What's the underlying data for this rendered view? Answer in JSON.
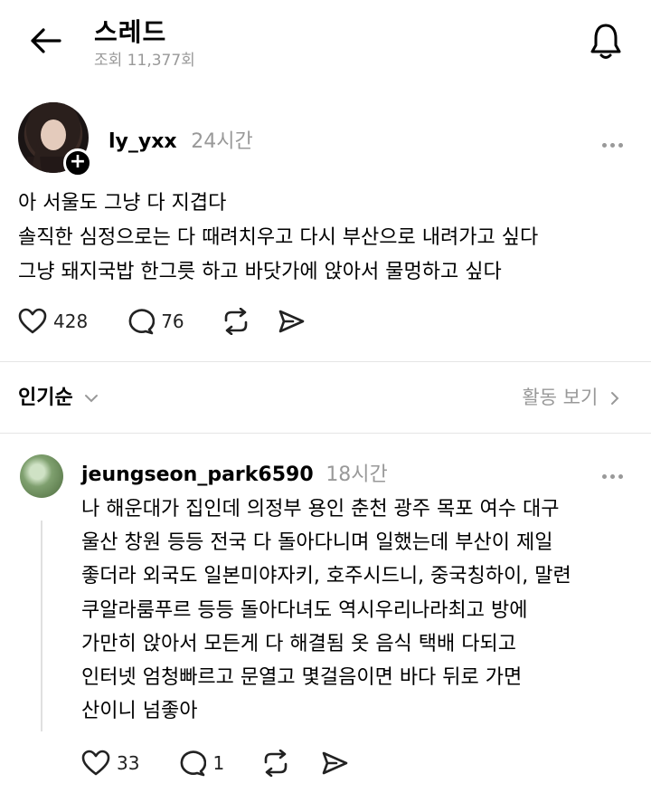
{
  "header": {
    "title": "스레드",
    "views_text": "조회 11,377회"
  },
  "post": {
    "username": "ly_yxx",
    "time": "24시간",
    "body": "아 서울도 그냥 다 지겹다\n솔직한 심정으로는 다 때려치우고 다시 부산으로 내려가고 싶다\n그냥 돼지국밥 한그릇 하고 바닷가에 앉아서 물멍하고 싶다",
    "likes": "428",
    "comments": "76"
  },
  "sort": {
    "label": "인기순",
    "activity_label": "활동 보기"
  },
  "reply": {
    "username": "jeungseon_park6590",
    "time": "18시간",
    "body": "나 해운대가 집인데  의정부 용인 춘천 광주 목포 여수 대구\n울산 창원 등등 전국 다 돌아다니며 일했는데 부산이 제일\n좋더라 외국도 일본미야자키, 호주시드니, 중국칭하이, 말련\n쿠알라룸푸르 등등  돌아다녀도 역시우리나라최고 방에\n가만히 앉아서 모든게 다 해결됨 옷 음식 택배 다되고\n인터넷 엄청빠르고 문열고 몇걸음이면 바다 뒤로 가면\n산이니 넘좋아",
    "likes": "33",
    "comments": "1"
  },
  "icons": [
    "back-arrow-icon",
    "bell-icon",
    "plus-icon",
    "more-icon",
    "heart-icon",
    "comment-icon",
    "repost-icon",
    "share-icon",
    "chevron-down-icon",
    "chevron-right-icon"
  ]
}
